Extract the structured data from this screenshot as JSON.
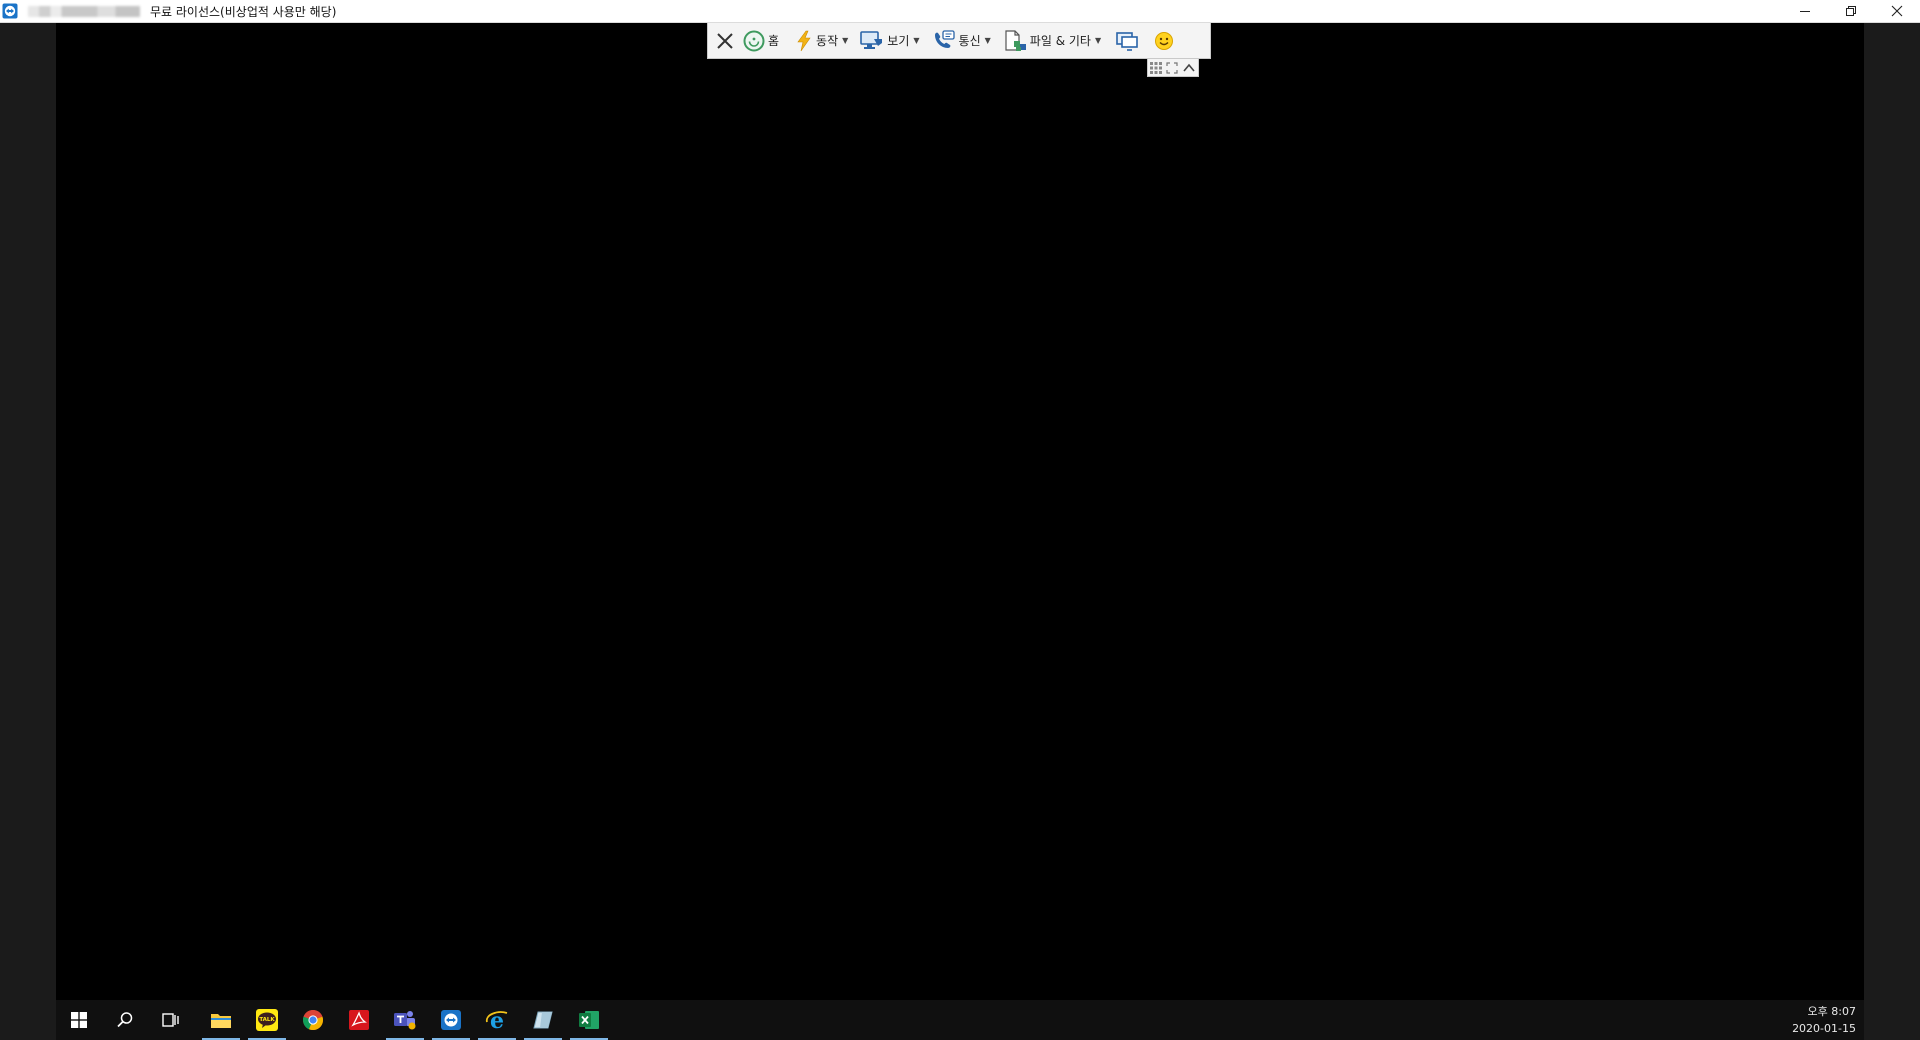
{
  "window": {
    "title": "무료 라이선스(비상업적 사용만 해당)",
    "icons": {
      "app": "remote-app-icon",
      "minimize": "minimize-icon",
      "restore": "restore-icon",
      "close": "close-icon"
    }
  },
  "toolbar": {
    "items": [
      {
        "id": "close",
        "icon": "close-x-icon",
        "label": ""
      },
      {
        "id": "home",
        "icon": "home-icon",
        "label": "홈"
      },
      {
        "id": "actions",
        "icon": "lightning-icon",
        "label": "동작",
        "dropdown": true
      },
      {
        "id": "view",
        "icon": "monitor-view-icon",
        "label": "보기",
        "dropdown": true
      },
      {
        "id": "comm",
        "icon": "phone-chat-icon",
        "label": "통신",
        "dropdown": true
      },
      {
        "id": "files",
        "icon": "file-transfer-icon",
        "label": "파일 & 기타",
        "dropdown": true
      },
      {
        "id": "screens",
        "icon": "dual-screen-icon",
        "label": ""
      },
      {
        "id": "feedback",
        "icon": "smiley-icon",
        "label": ""
      }
    ],
    "sub_icons": [
      "grid-icon",
      "expand-icon",
      "collapse-chevron-icon"
    ]
  },
  "taskbar": {
    "apps": [
      {
        "name": "start",
        "icon": "windows-start-icon",
        "active": false
      },
      {
        "name": "search",
        "icon": "search-icon",
        "active": false
      },
      {
        "name": "task-view",
        "icon": "task-view-icon",
        "active": false
      },
      {
        "name": "file-explorer",
        "icon": "folder-icon",
        "active": true
      },
      {
        "name": "kakaotalk",
        "icon": "kakaotalk-icon",
        "active": true,
        "label": "TALK"
      },
      {
        "name": "chrome",
        "icon": "chrome-icon",
        "active": false
      },
      {
        "name": "acrobat",
        "icon": "acrobat-icon",
        "active": false
      },
      {
        "name": "teams",
        "icon": "teams-icon",
        "active": true
      },
      {
        "name": "remote-desktop",
        "icon": "remote-app-icon",
        "active": true
      },
      {
        "name": "internet-explorer",
        "icon": "ie-icon",
        "active": true
      },
      {
        "name": "notes",
        "icon": "notes-icon",
        "active": true
      },
      {
        "name": "excel",
        "icon": "excel-icon",
        "active": true
      }
    ],
    "clock": {
      "time": "오후 8:07",
      "date": "2020-01-15"
    }
  },
  "colors": {
    "accent": "#1a73c7",
    "active_underline": "#7fb7e6",
    "remote_bg": "#000000"
  }
}
